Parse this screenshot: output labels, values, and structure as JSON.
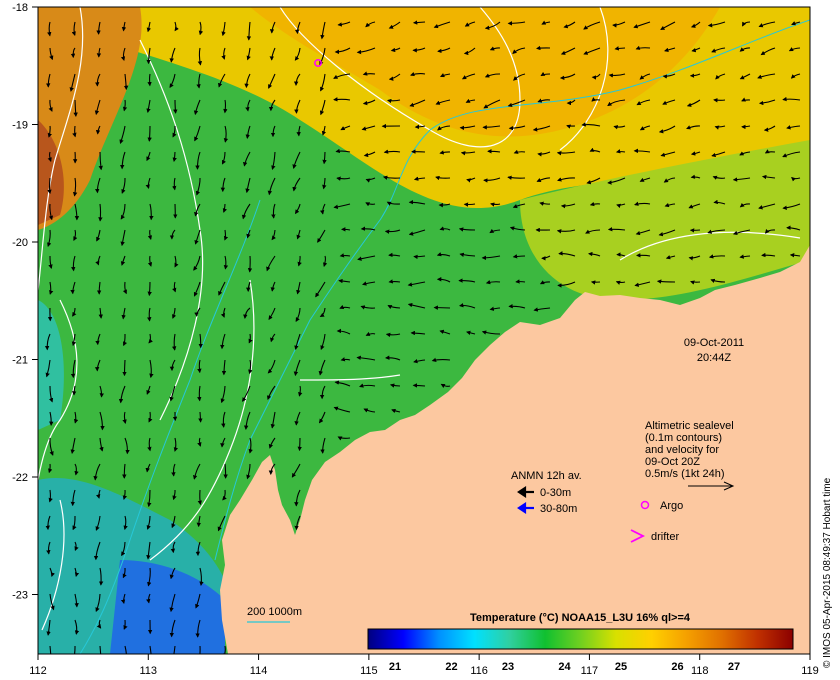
{
  "map": {
    "lon_ticks": [
      "112",
      "113",
      "114",
      "115",
      "116",
      "117",
      "118",
      "119"
    ],
    "lat_ticks": [
      "-18",
      "-19",
      "-20",
      "-21",
      "-22",
      "-23"
    ],
    "date": "09-Oct-2011",
    "time": "20:44Z",
    "colors": {
      "land": "#fcc8a0",
      "contour": "#ffffff",
      "bathymetry": "#27c8d8",
      "arrow_shallow": "#000000",
      "arrow_deep": "#0000ff",
      "argo": "#ff00ff",
      "drifter": "#ff00ff"
    }
  },
  "annotations": {
    "sealevel_lines": [
      "Altimetric sealevel",
      "(0.1m contours)",
      "and velocity for",
      "09-Oct 20Z",
      "0.5m/s (1kt 24h)"
    ],
    "argo_label": "Argo",
    "drifter_label": "drifter",
    "anmn_title": "ANMN 12h av.",
    "anmn_shallow": "0-30m",
    "anmn_deep": "30-80m",
    "bathy_label": "200  1000m"
  },
  "colorbar": {
    "title": "Temperature (°C) NOAA15_L3U 16% ql>=4",
    "ticks": [
      "21",
      "22",
      "23",
      "24",
      "25",
      "26",
      "27"
    ],
    "stops": [
      "#00007f",
      "#0000ff",
      "#0090ff",
      "#00e0ff",
      "#30d0a0",
      "#10c030",
      "#70d020",
      "#d8e000",
      "#ffd000",
      "#f5a000",
      "#e07000",
      "#c03000",
      "#8b0000"
    ]
  },
  "credit": "© IMOS 05-Apr-2015 08:49:37 Hobart time"
}
